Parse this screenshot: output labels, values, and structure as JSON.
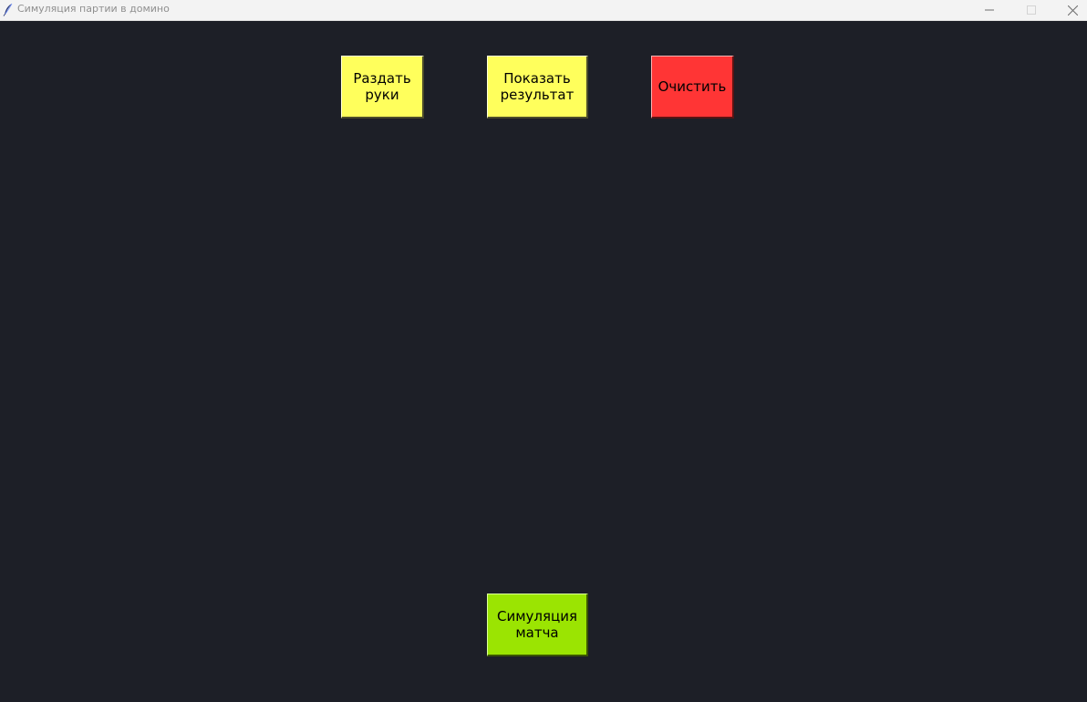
{
  "window": {
    "title": "Симуляция партии в домино",
    "app_icon": "feather-icon",
    "controls": {
      "minimize_icon": "minimize-icon",
      "maximize_icon": "maximize-icon",
      "close_icon": "close-icon"
    }
  },
  "buttons": {
    "deal_hands": "Раздать\nруки",
    "show_result": "Показать\nрезультат",
    "clear": "Очистить",
    "simulate_match": "Симуляция\nматча"
  },
  "colors": {
    "background": "#1d1f27",
    "deal_button": "#ffff5c",
    "result_button": "#ffff5c",
    "clear_button": "#ff3535",
    "simulate_button": "#9be402"
  }
}
